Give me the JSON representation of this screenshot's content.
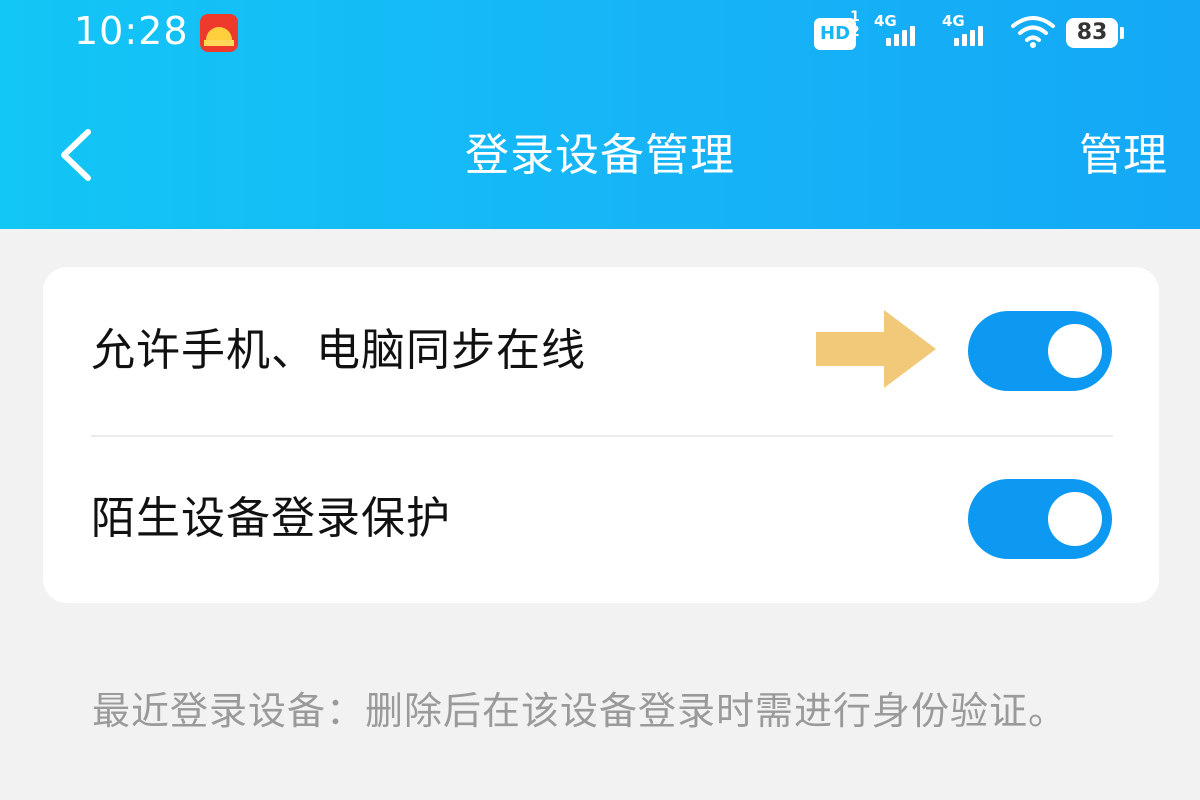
{
  "status_bar": {
    "time": "10:28",
    "hd_label": "HD",
    "hd_sub_top": "1",
    "hd_sub_bottom": "2",
    "signal_1_label": "4G",
    "signal_2_label": "4G",
    "battery": "83"
  },
  "header": {
    "title": "登录设备管理",
    "manage_label": "管理",
    "back_icon": "chevron-left-icon"
  },
  "settings": [
    {
      "label": "允许手机、电脑同步在线",
      "enabled": true
    },
    {
      "label": "陌生设备登录保护",
      "enabled": true
    }
  ],
  "note": "最近登录设备：删除后在该设备登录时需进行身份验证。",
  "colors": {
    "header_start": "#12c6f5",
    "header_end": "#14a8f6",
    "toggle_on": "#0d99f2",
    "arrow": "#f2c879",
    "background": "#f2f2f2"
  }
}
